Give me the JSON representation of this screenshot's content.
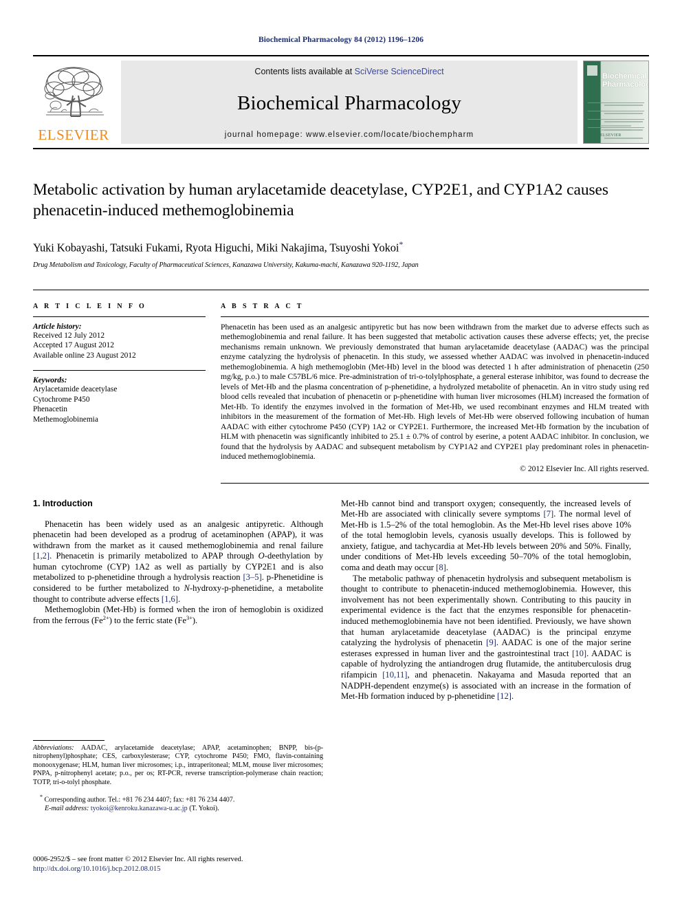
{
  "running_head": "Biochemical Pharmacology 84 (2012) 1196–1206",
  "masthead": {
    "contents_prefix": "Contents lists available at ",
    "sciencedirect_link": "SciVerse ScienceDirect",
    "journal_title": "Biochemical Pharmacology",
    "homepage": "journal homepage: www.elsevier.com/locate/biochempharm",
    "publisher_wordmark": "ELSEVIER",
    "cover_title_line1": "Biochemical",
    "cover_title_line2": "Pharmacology",
    "cover_publisher": "ELSEVIER"
  },
  "article": {
    "title": "Metabolic activation by human arylacetamide deacetylase, CYP2E1, and CYP1A2 causes phenacetin-induced methemoglobinemia",
    "authors": "Yuki Kobayashi, Tatsuki Fukami, Ryota Higuchi, Miki Nakajima, Tsuyoshi Yokoi",
    "corresponding_marker": "*",
    "affiliation": "Drug Metabolism and Toxicology, Faculty of Pharmaceutical Sciences, Kanazawa University, Kakuma-machi, Kanazawa 920-1192, Japan"
  },
  "article_info": {
    "heading": "A R T I C L E  I N F O",
    "history_label": "Article history:",
    "history": [
      "Received 12 July 2012",
      "Accepted 17 August 2012",
      "Available online 23 August 2012"
    ],
    "keywords_label": "Keywords:",
    "keywords": [
      "Arylacetamide deacetylase",
      "Cytochrome P450",
      "Phenacetin",
      "Methemoglobinemia"
    ]
  },
  "abstract": {
    "heading": "A B S T R A C T",
    "text": "Phenacetin has been used as an analgesic antipyretic but has now been withdrawn from the market due to adverse effects such as methemoglobinemia and renal failure. It has been suggested that metabolic activation causes these adverse effects; yet, the precise mechanisms remain unknown. We previously demonstrated that human arylacetamide deacetylase (AADAC) was the principal enzyme catalyzing the hydrolysis of phenacetin. In this study, we assessed whether AADAC was involved in phenacetin-induced methemoglobinemia. A high methemoglobin (Met-Hb) level in the blood was detected 1 h after administration of phenacetin (250 mg/kg, p.o.) to male C57BL/6 mice. Pre-administration of tri-o-tolylphosphate, a general esterase inhibitor, was found to decrease the levels of Met-Hb and the plasma concentration of p-phenetidine, a hydrolyzed metabolite of phenacetin. An in vitro study using red blood cells revealed that incubation of phenacetin or p-phenetidine with human liver microsomes (HLM) increased the formation of Met-Hb. To identify the enzymes involved in the formation of Met-Hb, we used recombinant enzymes and HLM treated with inhibitors in the measurement of the formation of Met-Hb. High levels of Met-Hb were observed following incubation of human AADAC with either cytochrome P450 (CYP) 1A2 or CYP2E1. Furthermore, the increased Met-Hb formation by the incubation of HLM with phenacetin was significantly inhibited to 25.1 ± 0.7% of control by eserine, a potent AADAC inhibitor. In conclusion, we found that the hydrolysis by AADAC and subsequent metabolism by CYP1A2 and CYP2E1 play predominant roles in phenacetin-induced methemoglobinemia.",
    "copyright": "© 2012 Elsevier Inc. All rights reserved."
  },
  "introduction": {
    "heading": "1. Introduction",
    "paragraph_1": "Phenacetin has been widely used as an analgesic antipyretic. Although phenacetin had been developed as a prodrug of acetaminophen (APAP), it was withdrawn from the market as it caused methemoglobinemia and renal failure [1,2]. Phenacetin is primarily metabolized to APAP through O-deethylation by human cytochrome (CYP) 1A2 as well as partially by CYP2E1 and is also metabolized to p-phenetidine through a hydrolysis reaction [3–5]. p-Phenetidine is considered to be further metabolized to N-hydroxy-p-phenetidine, a metabolite thought to contribute adverse effects [1,6].",
    "paragraph_2": "Methemoglobin (Met-Hb) is formed when the iron of hemoglobin is oxidized from the ferrous (Fe2+) to the ferric state (Fe3+).",
    "paragraph_3": "Met-Hb cannot bind and transport oxygen; consequently, the increased levels of Met-Hb are associated with clinically severe symptoms [7]. The normal level of Met-Hb is 1.5–2% of the total hemoglobin. As the Met-Hb level rises above 10% of the total hemoglobin levels, cyanosis usually develops. This is followed by anxiety, fatigue, and tachycardia at Met-Hb levels between 20% and 50%. Finally, under conditions of Met-Hb levels exceeding 50–70% of the total hemoglobin, coma and death may occur [8].",
    "paragraph_4": "The metabolic pathway of phenacetin hydrolysis and subsequent metabolism is thought to contribute to phenacetin-induced methemoglobinemia. However, this involvement has not been experimentally shown. Contributing to this paucity in experimental evidence is the fact that the enzymes responsible for phenacetin-induced methemoglobinemia have not been identified. Previously, we have shown that human arylacetamide deacetylase (AADAC) is the principal enzyme catalyzing the hydrolysis of phenacetin [9]. AADAC is one of the major serine esterases expressed in human liver and the gastrointestinal tract [10]. AADAC is capable of hydrolyzing the antiandrogen drug flutamide, the antituberculosis drug rifampicin [10,11], and phenacetin. Nakayama and Masuda reported that an NADPH-dependent enzyme(s) is associated with an increase in the formation of Met-Hb formation induced by p-phenetidine [12]."
  },
  "footnotes": {
    "abbreviations_label": "Abbreviations:",
    "abbreviations_text": " AADAC, arylacetamide deacetylase; APAP, acetaminophen; BNPP, bis-(p-nitrophenyl)phosphate; CES, carboxylesterase; CYP, cytochrome P450; FMO, flavin-containing monooxygenase; HLM, human liver microsomes; i.p., intraperitoneal; MLM, mouse liver microsomes; PNPA, p-nitrophenyl acetate; p.o., per os; RT-PCR, reverse transcription-polymerase chain reaction; TOTP, tri-o-tolyl phosphate.",
    "corresponding": "Corresponding author. Tel.: +81 76 234 4407; fax: +81 76 234 4407.",
    "email_label": "E-mail address:",
    "email": "tyokoi@kenroku.kanazawa-u.ac.jp",
    "email_suffix": "(T. Yokoi).",
    "imprint": "0006-2952/$ – see front matter © 2012 Elsevier Inc. All rights reserved.",
    "doi": "http://dx.doi.org/10.1016/j.bcp.2012.08.015"
  },
  "colors": {
    "link_blue": "#1b2a6b",
    "sciencedirect_blue": "#3a46a8",
    "elsevier_orange": "#f08a1c",
    "cover_green": "#2f6f4f"
  }
}
